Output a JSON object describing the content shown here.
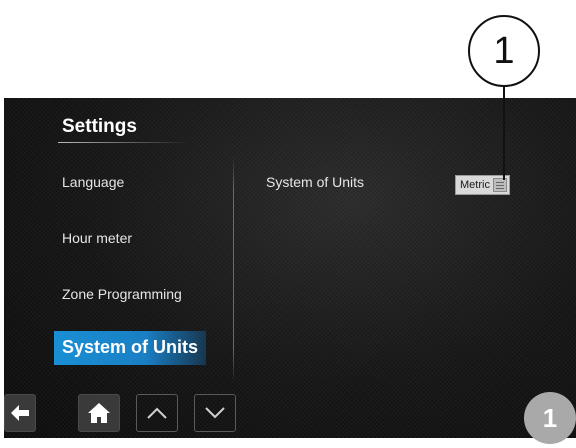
{
  "callout": {
    "number": "1"
  },
  "screen": {
    "title": "Settings",
    "menu": {
      "items": [
        {
          "label": "Language"
        },
        {
          "label": "Hour meter"
        },
        {
          "label": "Zone Programming"
        },
        {
          "label": "System of Units",
          "selected": true
        }
      ]
    },
    "detail": {
      "setting_label": "System of Units",
      "value": "Metric"
    }
  },
  "nav": {
    "buttons": [
      {
        "icon": "arrow-left-icon"
      },
      {
        "icon": "home-icon"
      },
      {
        "icon": "chevron-up-icon"
      },
      {
        "icon": "chevron-down-icon"
      }
    ]
  },
  "page_badge": "1",
  "colors": {
    "selected_highlight": "#1a8fd4",
    "screen_background": "#151515",
    "text": "#e6e6e6"
  }
}
